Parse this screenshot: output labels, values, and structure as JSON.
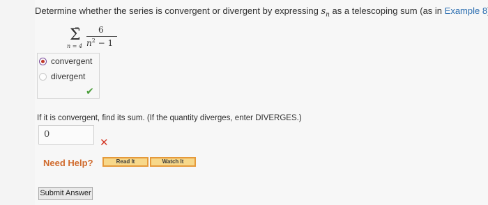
{
  "prompt": {
    "before": "Determine whether the series is convergent or divergent by expressing ",
    "var_s": "s",
    "var_n": "n",
    "after": " as a telescoping sum (as in ",
    "example_link": "Example 8",
    "end": ")."
  },
  "series": {
    "upper": "∞",
    "sigma": "Σ",
    "lower": "n = 4",
    "numerator": "6",
    "den_var": "n",
    "den_exp": "2",
    "den_rest": " − 1"
  },
  "choices": {
    "options": [
      {
        "label": "convergent",
        "selected": true
      },
      {
        "label": "divergent",
        "selected": false
      }
    ],
    "result_icon": "checkmark-icon"
  },
  "sum_prompt": "If it is convergent, find its sum. (If the quantity diverges, enter DIVERGES.)",
  "answer": {
    "value": "0",
    "result_icon": "cross-icon"
  },
  "help": {
    "label": "Need Help?",
    "read_it": "Read It",
    "watch_it": "Watch It"
  },
  "submit_label": "Submit Answer",
  "colors": {
    "link": "#2a6db0",
    "need_help": "#d06a2c",
    "help_button_bg": "#f7d88a",
    "help_button_border": "#e59a3b",
    "correct": "#4a9d3a",
    "incorrect": "#d43b2a"
  }
}
